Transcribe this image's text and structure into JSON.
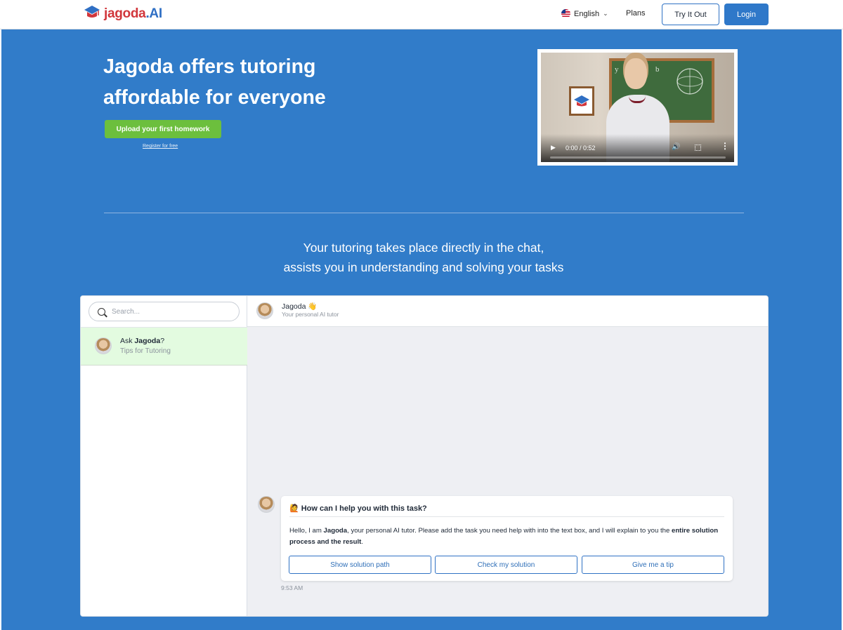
{
  "header": {
    "logo_brand": "jagoda",
    "logo_suffix": ".AI",
    "language": "English",
    "plans": "Plans",
    "try_label": "Try It Out",
    "login_label": "Login"
  },
  "hero": {
    "title_line1": "Jagoda offers tutoring",
    "title_line2": "affordable for everyone",
    "upload_label": "Upload your first homework",
    "register_label": "Register for free",
    "subtitle_line1": "Your tutoring takes place directly in the chat,",
    "subtitle_line2": "assists you in understanding and solving your tasks"
  },
  "video": {
    "time": "0:00 / 0:52",
    "progress": 0
  },
  "chat": {
    "search_placeholder": "Search...",
    "conversation": {
      "title_prefix": "Ask ",
      "title_bold": "Jagoda",
      "title_suffix": "?",
      "subtitle": "Tips for Tutoring"
    },
    "header": {
      "name": "Jagoda",
      "name_emoji": "👋",
      "subtitle": "Your personal AI tutor"
    },
    "message": {
      "title": "How can I help you with this task?",
      "text_1": "Hello, I am ",
      "text_bold_1": "Jagoda",
      "text_2": ", your personal AI tutor. Please add the task you need help with into the text box, and I will explain to you the ",
      "text_bold_2": "entire solution process and the result",
      "text_3": ".",
      "buttons": [
        "Show solution path",
        "Check my solution",
        "Give me a tip"
      ],
      "time": "9:53 AM"
    }
  },
  "colors": {
    "hero_bg": "#317cc9",
    "primary": "#2f78c9",
    "upload_green": "#6cbf3d",
    "selected_conv": "#e3fbe0"
  }
}
